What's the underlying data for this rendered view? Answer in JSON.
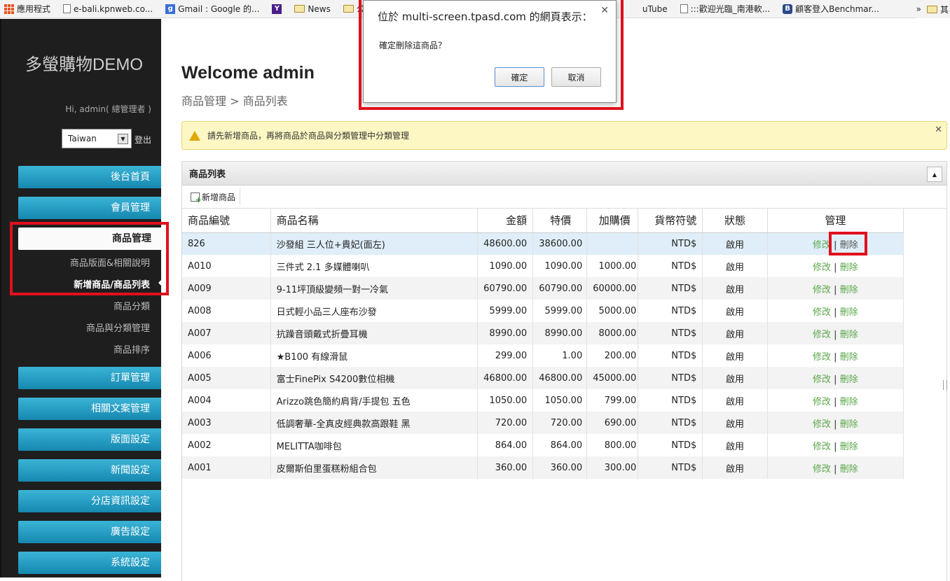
{
  "bookmarks": {
    "items": [
      {
        "label": "應用程式",
        "icon": "apps-icon"
      },
      {
        "label": "e-bali.kpnweb.co...",
        "icon": "page-icon"
      },
      {
        "label": "Gmail : Google 的...",
        "icon": "google-icon"
      },
      {
        "label": "",
        "icon": "yahoo-icon"
      },
      {
        "label": "News",
        "icon": "folder-icon"
      },
      {
        "label": "公",
        "icon": "folder-icon"
      }
    ],
    "items_right": [
      {
        "label": "uTube",
        "icon": ""
      },
      {
        "label": ":::歡迎光臨_南港軟...",
        "icon": "page-icon"
      },
      {
        "label": "顧客登入Benchmar...",
        "icon": "benchmark-icon"
      }
    ],
    "overflow": "»",
    "other": "其"
  },
  "sidebar": {
    "brand": "多螢購物DEMO",
    "greeting": "Hi, admin( 總管理者 )",
    "language": "Taiwan",
    "logout": "登出",
    "nav": {
      "home": "後台首頁",
      "members": "會員管理",
      "products": "商品管理",
      "orders": "訂單管理",
      "copywriting": "相關文案管理",
      "layout": "版面設定",
      "news": "新聞設定",
      "branches": "分店資訊設定",
      "ads": "廣告設定",
      "system": "系統設定"
    },
    "sub": {
      "layout_desc": "商品版面&相關說明",
      "add_list": "新增商品/商品列表",
      "category": "商品分類",
      "product_category": "商品與分類管理",
      "sort": "商品排序"
    }
  },
  "main": {
    "title": "Welcome admin",
    "breadcrumb": "商品管理 > 商品列表",
    "notice": "請先新增商品，再將商品於商品與分類管理中分類管理",
    "panel_title": "商品列表",
    "add_button": "新增商品",
    "columns": [
      "商品編號",
      "商品名稱",
      "金額",
      "特價",
      "加購價",
      "貨幣符號",
      "狀態",
      "管理"
    ],
    "edit": "修改",
    "delete": "刪除",
    "rows": [
      {
        "code": "826",
        "name": "沙發組 三人位+貴妃(面左)",
        "price": "48600.00",
        "special": "38600.00",
        "addon": "",
        "currency": "NTD$",
        "status": "啟用"
      },
      {
        "code": "A010",
        "name": "三件式 2.1 多媒體喇叭",
        "price": "1090.00",
        "special": "1090.00",
        "addon": "1000.00",
        "currency": "NTD$",
        "status": "啟用"
      },
      {
        "code": "A009",
        "name": "9-11坪頂級變頻一對一冷氣",
        "price": "60790.00",
        "special": "60790.00",
        "addon": "60000.00",
        "currency": "NTD$",
        "status": "啟用"
      },
      {
        "code": "A008",
        "name": "日式輕小品三人座布沙發",
        "price": "5999.00",
        "special": "5999.00",
        "addon": "5000.00",
        "currency": "NTD$",
        "status": "啟用"
      },
      {
        "code": "A007",
        "name": "抗躁音頭戴式折疊耳機",
        "price": "8990.00",
        "special": "8990.00",
        "addon": "8000.00",
        "currency": "NTD$",
        "status": "啟用"
      },
      {
        "code": "A006",
        "name": "★B100 有線滑鼠",
        "price": "299.00",
        "special": "1.00",
        "addon": "200.00",
        "currency": "NTD$",
        "status": "啟用"
      },
      {
        "code": "A005",
        "name": "富士FinePix S4200數位相機",
        "price": "46800.00",
        "special": "46800.00",
        "addon": "45000.00",
        "currency": "NTD$",
        "status": "啟用"
      },
      {
        "code": "A004",
        "name": "Arizzo跳色簡約肩背/手提包 五色",
        "price": "1050.00",
        "special": "1050.00",
        "addon": "799.00",
        "currency": "NTD$",
        "status": "啟用"
      },
      {
        "code": "A003",
        "name": "低調奢華-全真皮經典款高跟鞋 黑",
        "price": "720.00",
        "special": "720.00",
        "addon": "690.00",
        "currency": "NTD$",
        "status": "啟用"
      },
      {
        "code": "A002",
        "name": "MELITTA咖啡包",
        "price": "864.00",
        "special": "864.00",
        "addon": "800.00",
        "currency": "NTD$",
        "status": "啟用"
      },
      {
        "code": "A001",
        "name": "皮爾斯伯里蛋糕粉組合包",
        "price": "360.00",
        "special": "360.00",
        "addon": "300.00",
        "currency": "NTD$",
        "status": "啟用"
      }
    ]
  },
  "dialog": {
    "title": "位於 multi-screen.tpasd.com 的網頁表示：",
    "message": "確定刪除這商品？",
    "ok": "確定",
    "cancel": "取消"
  },
  "colors": {
    "nav_button": "#1f9ac4",
    "link": "#5aa74a",
    "highlight": "#e0101c",
    "notice_bg": "#fdf7c3"
  }
}
